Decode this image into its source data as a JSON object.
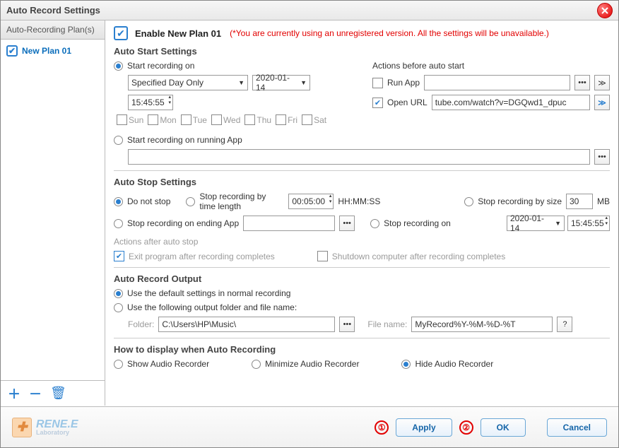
{
  "window": {
    "title": "Auto Record Settings"
  },
  "sidebar": {
    "header": "Auto-Recording Plan(s)",
    "plan": "New Plan 01"
  },
  "enable": {
    "label": "Enable New Plan 01",
    "warning": "(*You are currently using an unregistered version. All the settings will be unavailable.)"
  },
  "auto_start": {
    "title": "Auto Start Settings",
    "opt_on": "Start recording on",
    "mode": "Specified Day Only",
    "date": "2020-01-14",
    "time": "15:45:55",
    "days": [
      "Sun",
      "Mon",
      "Tue",
      "Wed",
      "Thu",
      "Fri",
      "Sat"
    ],
    "opt_app": "Start recording on running App",
    "actions_label": "Actions before auto start",
    "run_app": "Run App",
    "open_url": "Open URL",
    "url_value": "tube.com/watch?v=DGQwd1_dpuc"
  },
  "auto_stop": {
    "title": "Auto Stop Settings",
    "opt_none": "Do not stop",
    "opt_time": "Stop recording by time length",
    "time_value": "00:05:00",
    "time_unit": "HH:MM:SS",
    "opt_size": "Stop recording by size",
    "size_value": "30",
    "size_unit": "MB",
    "opt_ending_app": "Stop recording on ending App",
    "opt_on": "Stop recording on",
    "date": "2020-01-14",
    "time": "15:45:55",
    "actions_label": "Actions after auto stop",
    "exit_label": "Exit program after recording completes",
    "shutdown_label": "Shutdown computer after recording completes"
  },
  "output": {
    "title": "Auto Record Output",
    "opt_default": "Use the default settings in normal recording",
    "opt_custom": "Use the following output folder and file name:",
    "folder_label": "Folder:",
    "folder_value": "C:\\Users\\HP\\Music\\",
    "file_label": "File name:",
    "file_value": "MyRecord%Y-%M-%D-%T"
  },
  "display": {
    "title": "How to display when Auto Recording",
    "opt_show": "Show Audio Recorder",
    "opt_min": "Minimize Audio Recorder",
    "opt_hide": "Hide Audio Recorder"
  },
  "footer": {
    "brand": "RENE.E",
    "brand_sub": "Laboratory",
    "apply": "Apply",
    "ok": "OK",
    "cancel": "Cancel",
    "ann1": "①",
    "ann2": "②"
  }
}
